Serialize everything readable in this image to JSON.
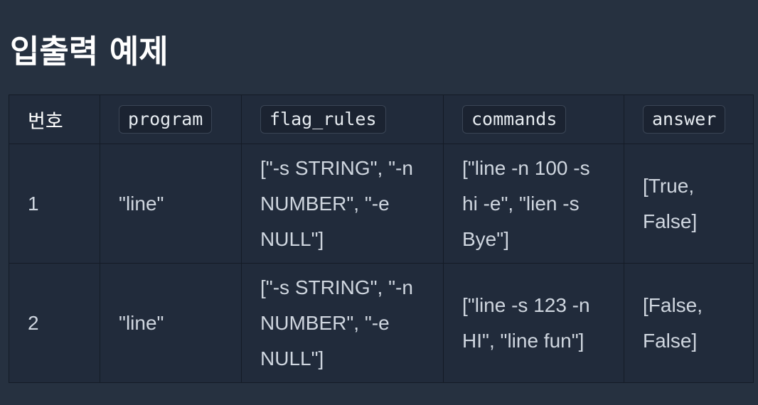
{
  "section": {
    "title": "입출력 예제"
  },
  "table": {
    "headers": {
      "number": "번호",
      "program": "program",
      "flag_rules": "flag_rules",
      "commands": "commands",
      "answer": "answer"
    },
    "rows": [
      {
        "number": "1",
        "program": "\"line\"",
        "flag_rules": "[\"-s STRING\", \"-n NUMBER\", \"-e NULL\"]",
        "commands": "[\"line -n 100 -s hi -e\", \"lien -s Bye\"]",
        "answer": "[True, False]"
      },
      {
        "number": "2",
        "program": "\"line\"",
        "flag_rules": "[\"-s STRING\", \"-n NUMBER\", \"-e NULL\"]",
        "commands": "[\"line -s 123 -n HI\", \"line fun\"]",
        "answer": "[False, False]"
      }
    ]
  }
}
